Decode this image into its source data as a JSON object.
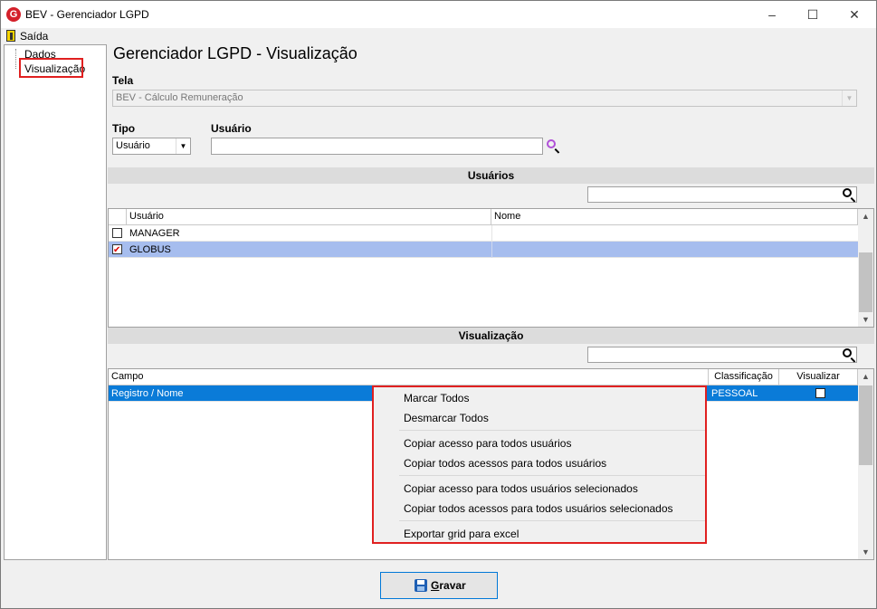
{
  "window": {
    "title": "BEV - Gerenciador LGPD",
    "minimize": "–",
    "maximize": "☐",
    "close": "✕"
  },
  "menubar": {
    "exit": "Saída"
  },
  "sidebar": {
    "items": [
      "Dados",
      "Visualização"
    ]
  },
  "page_title": "Gerenciador LGPD - Visualização",
  "tela": {
    "label": "Tela",
    "value": "BEV - Cálculo Remuneração"
  },
  "tipo": {
    "label": "Tipo",
    "value": "Usuário"
  },
  "usuario": {
    "label": "Usuário",
    "value": ""
  },
  "users_section": {
    "title": "Usuários",
    "columns": [
      "Usuário",
      "Nome"
    ],
    "rows": [
      {
        "user": "MANAGER",
        "name": "",
        "checked": false
      },
      {
        "user": "GLOBUS",
        "name": "",
        "checked": true
      }
    ]
  },
  "view_section": {
    "title": "Visualização",
    "columns": [
      "Campo",
      "Classificação",
      "Visualizar"
    ],
    "rows": [
      {
        "campo": "Registro / Nome",
        "classificacao": "PESSOAL",
        "visualizar": false
      }
    ]
  },
  "context_menu": [
    "Marcar Todos",
    "Desmarcar Todos",
    "Copiar acesso para todos usuários",
    "Copiar todos acessos para todos usuários",
    "Copiar acesso para todos usuários selecionados",
    "Copiar todos acessos para todos usuários selecionados",
    "Exportar grid para excel"
  ],
  "save_button": {
    "mnemonic": "G",
    "rest": "ravar"
  },
  "colors": {
    "selection": "#a6bdee",
    "row_highlight": "#0a7bd8",
    "highlight_box": "#e02020"
  }
}
